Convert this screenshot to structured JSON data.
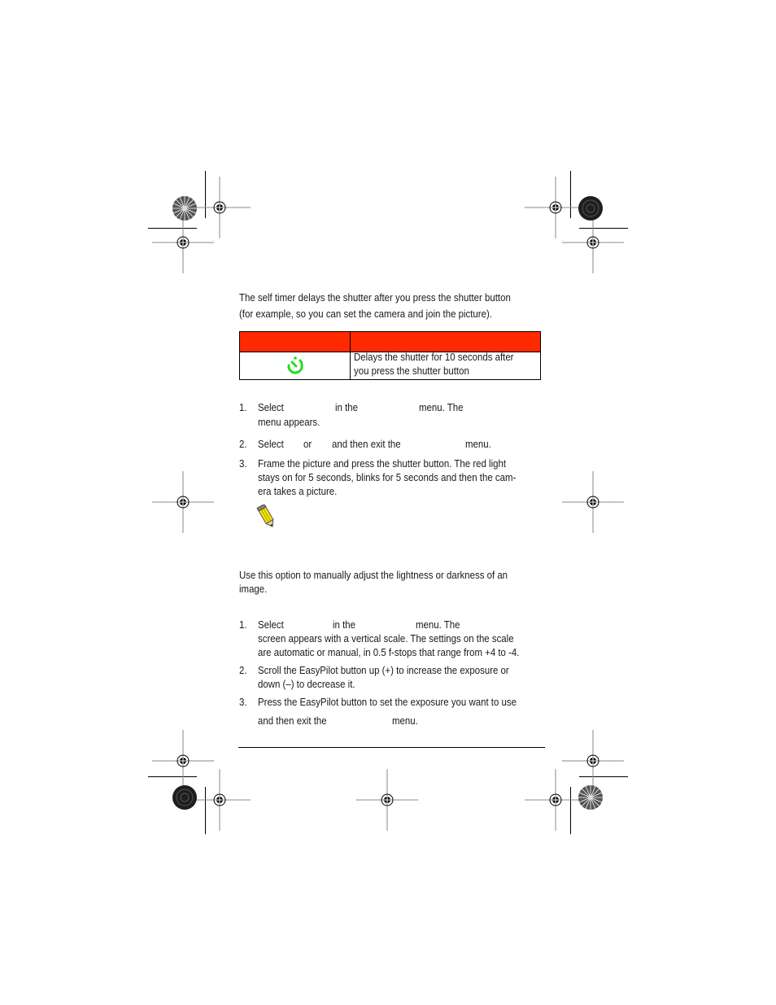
{
  "self_timer": {
    "intro_line1": "The self timer delays the shutter after you press the shutter button",
    "intro_line2": "(for example, so you can set the camera and join the picture).",
    "table": {
      "header_color": "#ff2a00",
      "rows": [
        {
          "icon": "self-timer-icon",
          "icon_color": "#22dd22",
          "description_line1": "Delays the shutter for 10 seconds after",
          "description_line2": "you press the shutter button"
        }
      ]
    },
    "steps": [
      {
        "number": "1.",
        "parts": [
          "Select",
          "in the",
          "menu. The"
        ],
        "line2": "menu appears."
      },
      {
        "number": "2.",
        "parts": [
          "Select",
          "or",
          "and then exit the",
          "menu."
        ]
      },
      {
        "number": "3.",
        "line1": "Frame the picture and press the shutter button. The red light",
        "line2": "stays on for 5 seconds, blinks for 5 seconds and then the cam-",
        "line3": "era takes a picture."
      }
    ],
    "note_icon": "pencil-note-icon"
  },
  "exposure": {
    "intro_line1": "Use this option to manually adjust the lightness or darkness of an",
    "intro_line2": "image.",
    "steps": [
      {
        "number": "1.",
        "parts": [
          "Select",
          "in the",
          "menu. The"
        ],
        "line2": "screen appears with a vertical scale. The settings on the scale",
        "line3": "are automatic or manual, in 0.5 f-stops that range from +4 to -4."
      },
      {
        "number": "2.",
        "line1": "Scroll the EasyPilot button up (+) to increase the exposure or",
        "line2": "down (–) to decrease it."
      },
      {
        "number": "3.",
        "line1": "Press the EasyPilot button to set the exposure you want to use",
        "parts": [
          "and then exit the",
          "menu."
        ]
      }
    ]
  }
}
